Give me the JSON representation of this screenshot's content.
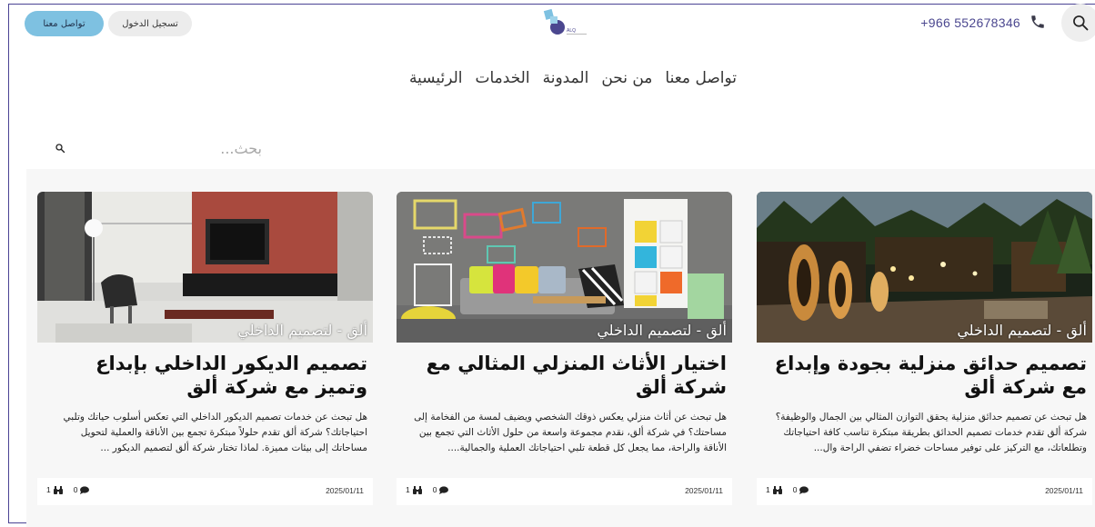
{
  "header": {
    "contact_label": "تواصل معنا",
    "login_label": "تسجيل الدخول",
    "phone": "+966 552678346",
    "logo_text": "ALQ"
  },
  "nav": {
    "items": [
      {
        "label": "الرئيسية"
      },
      {
        "label": "الخدمات"
      },
      {
        "label": "المدونة"
      },
      {
        "label": "من نحن"
      },
      {
        "label": "تواصل معنا"
      }
    ]
  },
  "search": {
    "placeholder": "بحث..."
  },
  "colors": {
    "accent_blue": "#7ec1e1",
    "brand_purple": "#4b478f"
  },
  "posts": [
    {
      "category": "ألق - لتصميم الداخلي",
      "title": "تصميم حدائق منزلية بجودة وإبداع مع شركة ألق",
      "excerpt": "هل تبحث عن تصميم حدائق منزلية يحقق التوازن المثالي بين الجمال والوظيفة؟ شركة ألق تقدم خدمات تصميم الحدائق بطريقة مبتكرة تناسب كافة احتياجاتك وتطلعاتك، مع التركيز على توفير مساحات خضراء تضفي الراحة وال...",
      "date": "2025/01/11",
      "views": "1",
      "comments": "0",
      "image": "garden"
    },
    {
      "category": "ألق - لتصميم الداخلي",
      "title": "اختيار الأثاث المنزلي المثالي مع شركة ألق",
      "excerpt": "هل تبحث عن أثاث منزلي يعكس ذوقك الشخصي ويضيف لمسة من الفخامة إلى مساحتك؟ في شركة ألق، نقدم مجموعة واسعة من حلول الأثاث التي تجمع بين الأناقة والراحة، مما يجعل كل قطعة تلبي احتياجاتك العملية والجمالية....",
      "date": "2025/01/11",
      "views": "1",
      "comments": "0",
      "image": "furniture"
    },
    {
      "category": "ألق - لتصميم الداخلي",
      "title": "تصميم الديكور الداخلي بإبداع وتميز مع شركة ألق",
      "excerpt": "هل تبحث عن خدمات تصميم الديكور الداخلي التي تعكس أسلوب حياتك وتلبي احتياجاتك؟ شركة ألق تقدم حلولاً مبتكرة تجمع بين الأناقة والعملية لتحويل مساحاتك إلى بيئات مميزة. لماذا تختار شركة ألق لتصميم الديكور ...",
      "date": "2025/01/11",
      "views": "1",
      "comments": "0",
      "image": "living-room"
    }
  ]
}
